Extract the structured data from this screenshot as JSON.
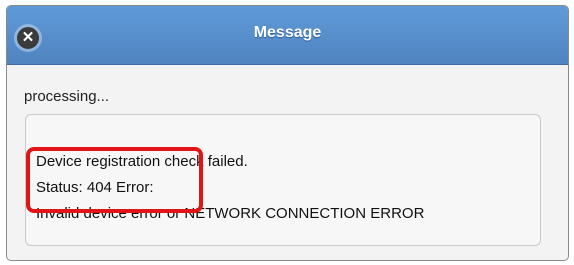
{
  "dialog": {
    "title": "Message",
    "close_icon": "close-icon",
    "status_text": "processing...",
    "message_lines": [
      "Device registration check failed.",
      "Status: 404 Error:",
      "Invalid device error or NETWORK CONNECTION ERROR"
    ]
  },
  "colors": {
    "title_bar": "#5a91d0",
    "highlight": "#e01616"
  }
}
